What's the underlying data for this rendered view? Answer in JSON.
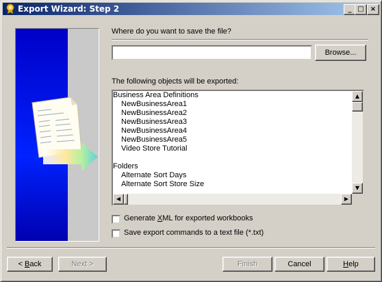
{
  "window": {
    "title": "Export Wizard: Step 2",
    "controls": {
      "minimize": "_",
      "maximize": "□",
      "close": "×"
    }
  },
  "location": {
    "prompt": "Where do you want to save the file?",
    "file_value": "",
    "browse_label": "Browse..."
  },
  "objects": {
    "heading": "The following objects will be exported:",
    "items": [
      {
        "text": "Business Area Definitions",
        "level": 0
      },
      {
        "text": "NewBusinessArea1",
        "level": 1
      },
      {
        "text": "NewBusinessArea2",
        "level": 1
      },
      {
        "text": "NewBusinessArea3",
        "level": 1
      },
      {
        "text": "NewBusinessArea4",
        "level": 1
      },
      {
        "text": "NewBusinessArea5",
        "level": 1
      },
      {
        "text": "Video Store Tutorial",
        "level": 1
      },
      {
        "text": "",
        "level": 0
      },
      {
        "text": "Folders",
        "level": 0
      },
      {
        "text": "Alternate Sort Days",
        "level": 1
      },
      {
        "text": "Alternate Sort Store Size",
        "level": 1
      }
    ]
  },
  "options": {
    "xml_pre": "Generate ",
    "xml_key": "X",
    "xml_post": "ML for exported workbooks",
    "xml_checked": false,
    "txt_label": "Save export commands to a text file (*.txt)",
    "txt_checked": false
  },
  "footer": {
    "back_arrow": "<",
    "back_key": "B",
    "back_rest": "ack",
    "next_label": "Next >",
    "finish_label": "Finish",
    "cancel_label": "Cancel",
    "help_key": "H",
    "help_rest": "elp"
  }
}
